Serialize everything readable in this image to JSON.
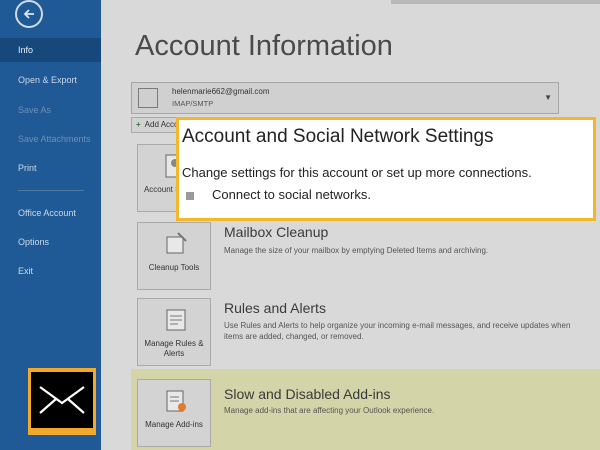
{
  "sidebar": {
    "items": [
      {
        "label": "Info",
        "active": true
      },
      {
        "label": "Open & Export"
      },
      {
        "label": "Save As"
      },
      {
        "label": "Save Attachments"
      },
      {
        "label": "Print"
      },
      {
        "label": "Office Account"
      },
      {
        "label": "Options"
      },
      {
        "label": "Exit"
      }
    ]
  },
  "main": {
    "title": "Account Information",
    "account": {
      "email": "helenmarie662@gmail.com",
      "type": "IMAP/SMTP"
    },
    "add_account_label": "Add Account",
    "sections": [
      {
        "tile_label": "Account Settings",
        "title": "Account and Social Network Settings",
        "desc": ""
      },
      {
        "tile_label": "Cleanup Tools",
        "title": "Mailbox Cleanup",
        "desc": "Manage the size of your mailbox by emptying Deleted Items and archiving."
      },
      {
        "tile_label": "Manage Rules & Alerts",
        "title": "Rules and Alerts",
        "desc": "Use Rules and Alerts to help organize your incoming e-mail messages, and receive updates when items are added, changed, or removed."
      },
      {
        "tile_label": "Manage Add-ins",
        "title": "Slow and Disabled Add-ins",
        "desc": "Manage add-ins that are affecting your Outlook experience."
      }
    ]
  },
  "callout": {
    "title": "Account and Social Network Settings",
    "desc": "Change settings for this account or set up more connections.",
    "link": "Connect to social networks."
  },
  "colors": {
    "sidebar": "#1f5a96",
    "highlight_border": "#f4b62b",
    "logo_bg": "#f0a92a"
  }
}
